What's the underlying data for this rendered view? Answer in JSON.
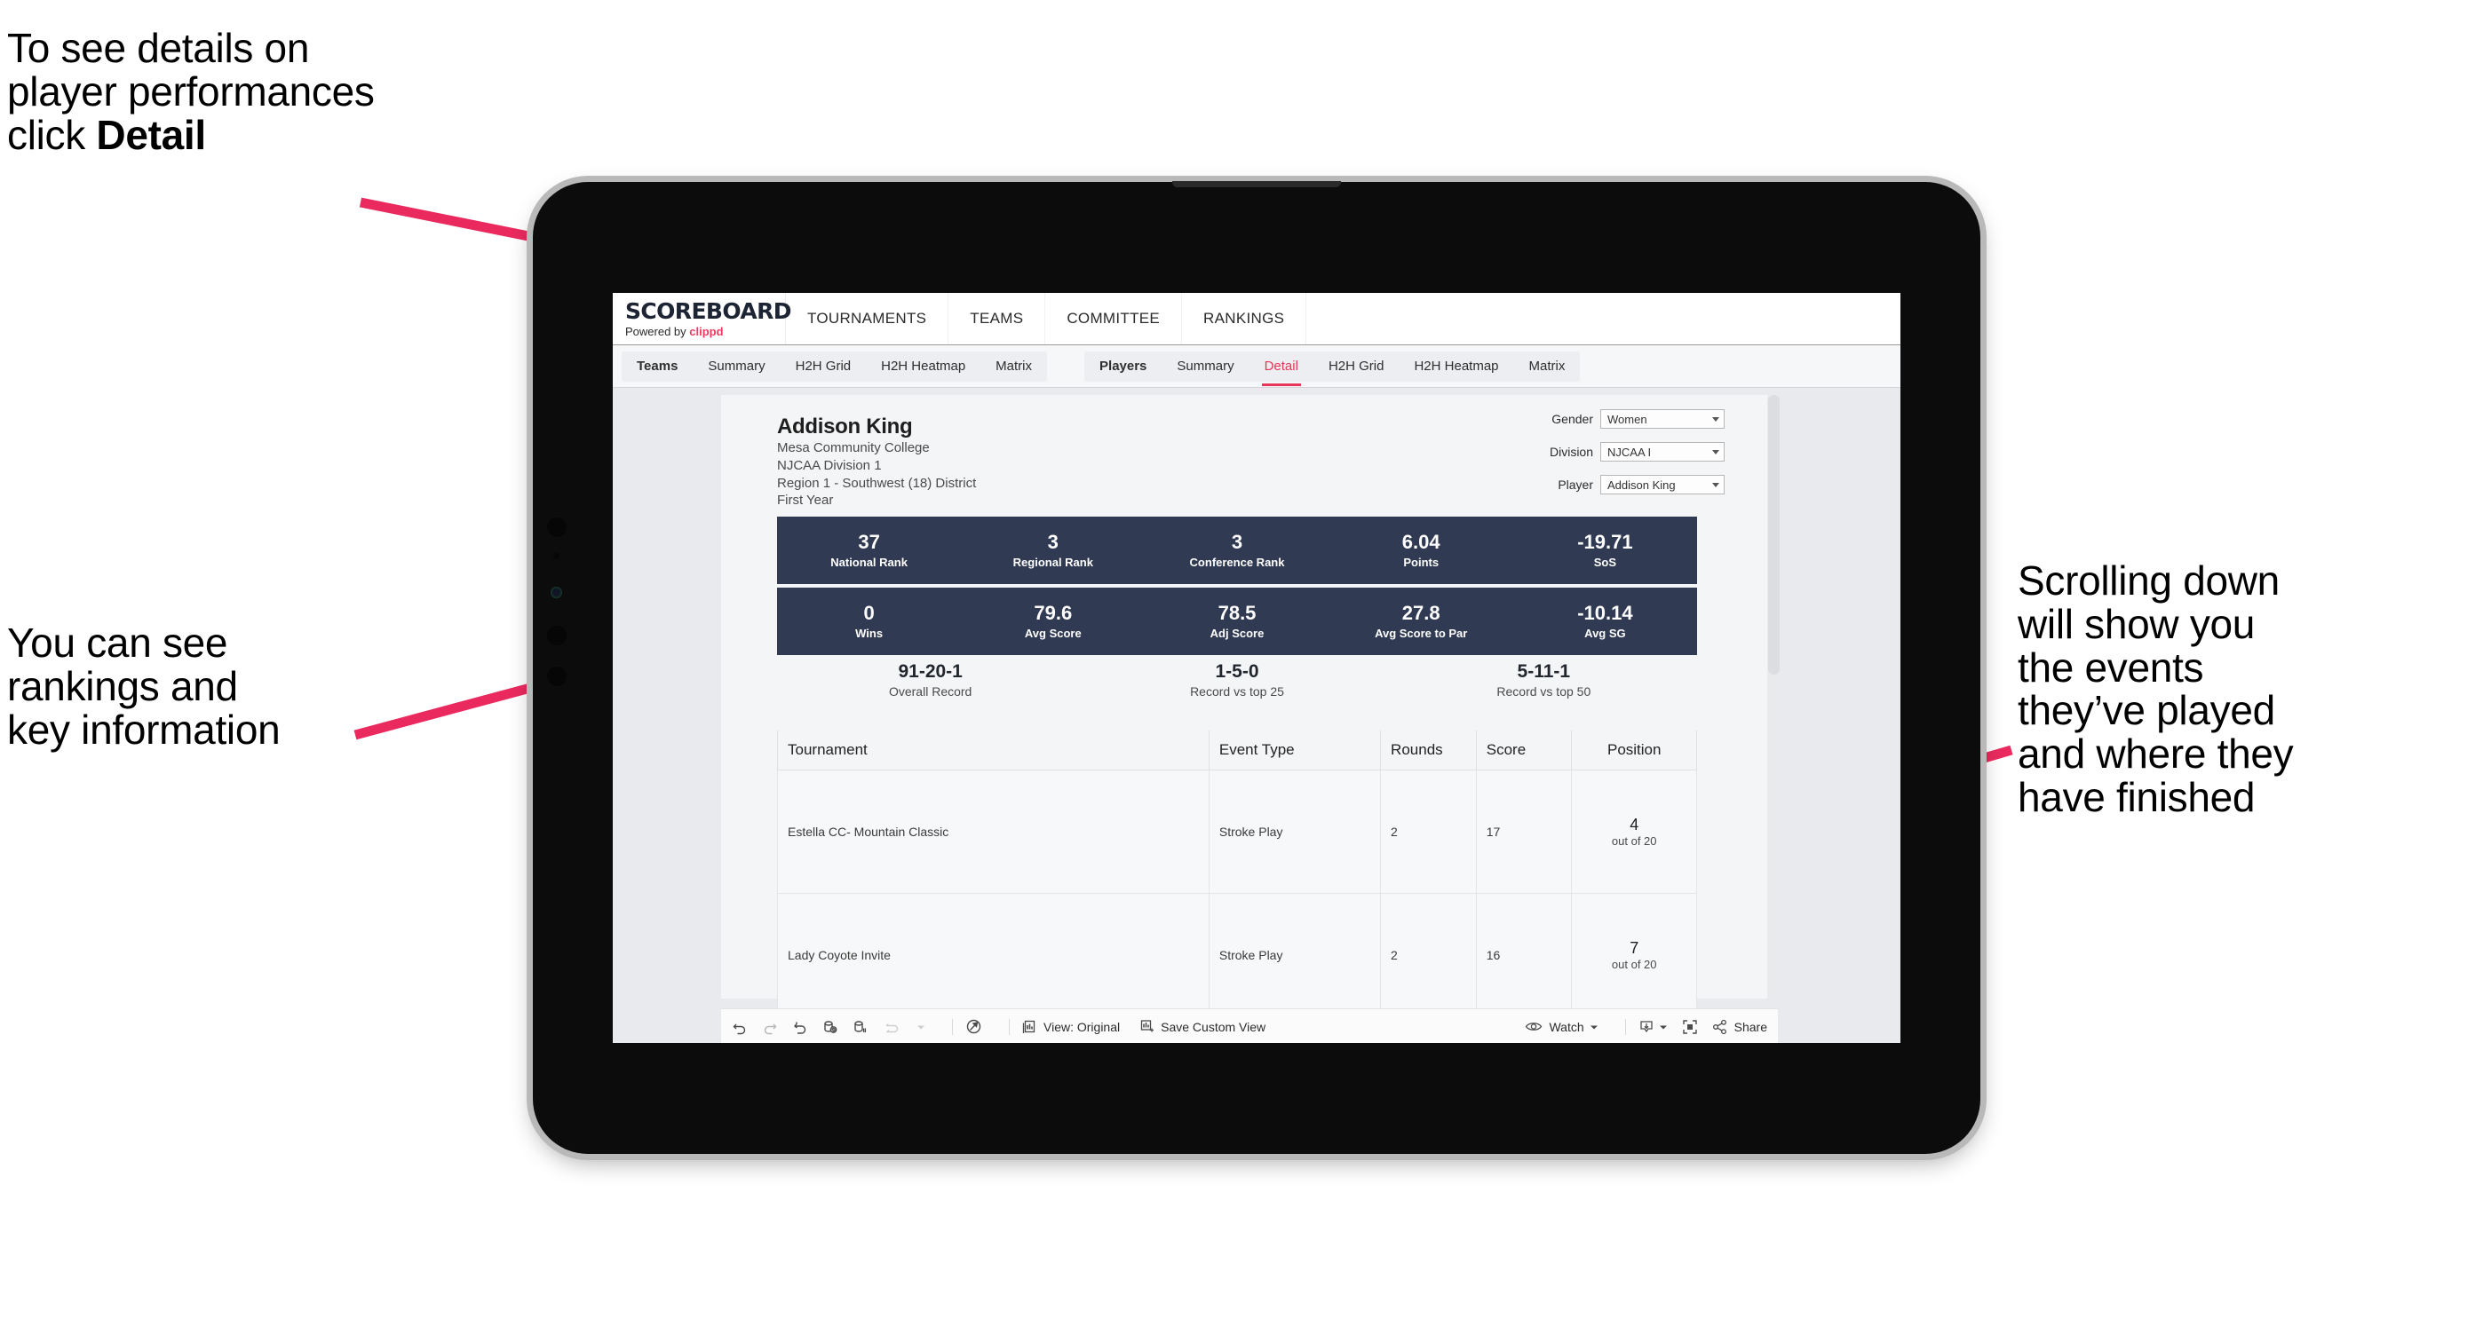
{
  "annotations": {
    "detail": "To see details on\nplayer performances\nclick ",
    "detail_bold": "Detail",
    "rankings": "You can see\nrankings and\nkey information",
    "scrolling": "Scrolling down\nwill show you\nthe events\nthey’ve played\nand where they\nhave finished"
  },
  "colors": {
    "accent_pink": "#e8355a",
    "arrow_pink": "#ea2a5f",
    "stat_navy": "#303a52"
  },
  "app": {
    "brand": {
      "title": "SCOREBOARD",
      "powered_prefix": "Powered by ",
      "powered_brand": "clippd"
    },
    "topnav": [
      "TOURNAMENTS",
      "TEAMS",
      "COMMITTEE",
      "RANKINGS"
    ],
    "tabs_teams": [
      "Teams",
      "Summary",
      "H2H Grid",
      "H2H Heatmap",
      "Matrix"
    ],
    "tabs_players": [
      "Players",
      "Summary",
      "Detail",
      "H2H Grid",
      "H2H Heatmap",
      "Matrix"
    ],
    "tabs_players_active": "Detail"
  },
  "player": {
    "name": "Addison King",
    "school": "Mesa Community College",
    "division": "NJCAA Division 1",
    "region": "Region 1 - Southwest (18) District",
    "year": "First Year"
  },
  "filters": [
    {
      "label": "Gender",
      "value": "Women"
    },
    {
      "label": "Division",
      "value": "NJCAA I"
    },
    {
      "label": "Player",
      "value": "Addison King"
    }
  ],
  "stats_row1": [
    {
      "value": "37",
      "label": "National Rank"
    },
    {
      "value": "3",
      "label": "Regional Rank"
    },
    {
      "value": "3",
      "label": "Conference Rank"
    },
    {
      "value": "6.04",
      "label": "Points"
    },
    {
      "value": "-19.71",
      "label": "SoS"
    }
  ],
  "stats_row2": [
    {
      "value": "0",
      "label": "Wins"
    },
    {
      "value": "79.6",
      "label": "Avg Score"
    },
    {
      "value": "78.5",
      "label": "Adj Score"
    },
    {
      "value": "27.8",
      "label": "Avg Score to Par"
    },
    {
      "value": "-10.14",
      "label": "Avg SG"
    }
  ],
  "records": [
    {
      "value": "91-20-1",
      "label": "Overall Record"
    },
    {
      "value": "1-5-0",
      "label": "Record vs top 25"
    },
    {
      "value": "5-11-1",
      "label": "Record vs top 50"
    }
  ],
  "table": {
    "headers": [
      "Tournament",
      "Event Type",
      "Rounds",
      "Score",
      "Position"
    ],
    "rows": [
      {
        "tournament": "Estella CC- Mountain Classic",
        "event_type": "Stroke Play",
        "rounds": "2",
        "score": "17",
        "position": "4",
        "position_sub": "out of 20"
      },
      {
        "tournament": "Lady Coyote Invite",
        "event_type": "Stroke Play",
        "rounds": "2",
        "score": "16",
        "position": "7",
        "position_sub": "out of 20"
      }
    ]
  },
  "toolbar": {
    "view_label": "View: Original",
    "save_view_label": "Save Custom View",
    "watch_label": "Watch",
    "share_label": "Share"
  }
}
